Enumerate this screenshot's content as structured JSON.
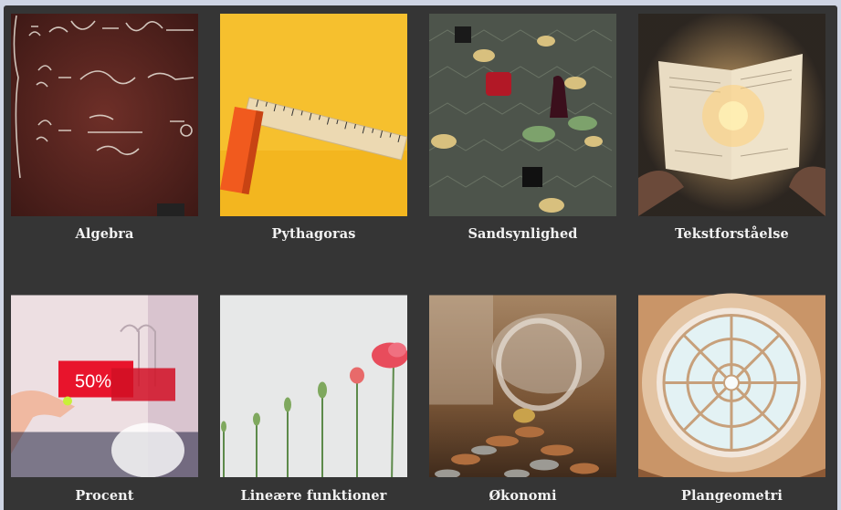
{
  "topics": [
    {
      "label": "Algebra",
      "image": "chalkboard-equations-image"
    },
    {
      "label": "Pythagoras",
      "image": "ruler-on-yellow-image"
    },
    {
      "label": "Sandsynlighed",
      "image": "board-game-pieces-image"
    },
    {
      "label": "Tekstforståelse",
      "image": "glowing-book-image"
    },
    {
      "label": "Procent",
      "image": "sale-tag-50-percent-image"
    },
    {
      "label": "Lineære funktioner",
      "image": "flower-stems-image"
    },
    {
      "label": "Økonomi",
      "image": "coin-jar-image"
    },
    {
      "label": "Plangeometri",
      "image": "glass-dome-ceiling-image"
    }
  ],
  "sale_tag_text": "50%"
}
